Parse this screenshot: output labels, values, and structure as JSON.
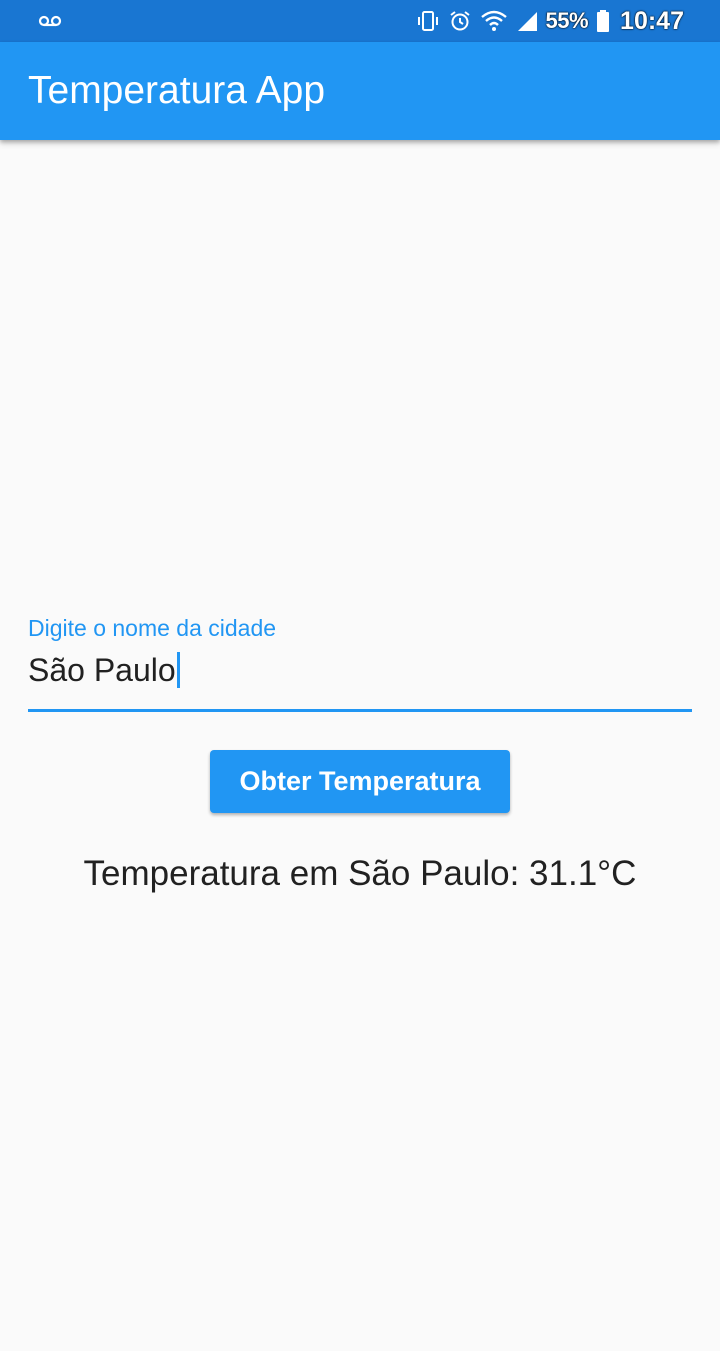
{
  "status_bar": {
    "icons": [
      "voicemail-icon",
      "vibrate-icon",
      "alarm-icon",
      "wifi-icon",
      "signal-icon",
      "battery-icon"
    ],
    "battery_percent": "55%",
    "time": "10:47",
    "color": "#1976d2"
  },
  "app_bar": {
    "title": "Temperatura App",
    "color": "#2196f3"
  },
  "city_field": {
    "label": "Digite o nome da cidade",
    "value": "São Paulo",
    "accent_color": "#2196f3"
  },
  "button": {
    "label": "Obter Temperatura"
  },
  "result": {
    "text": "Temperatura em São Paulo: 31.1°C"
  }
}
